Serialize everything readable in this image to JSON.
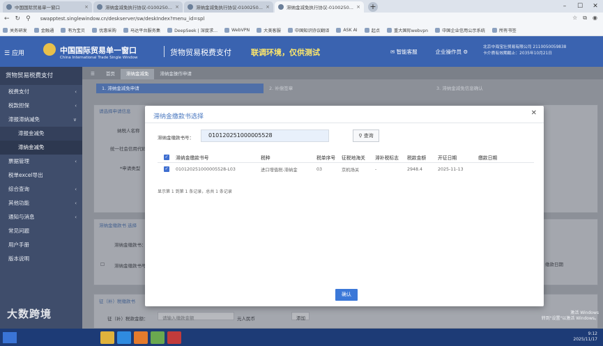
{
  "browser": {
    "tabs": [
      {
        "label": "中国国际贸易单一窗口",
        "active": false
      },
      {
        "label": "滞纳金减免执行协议-0100250...",
        "active": false
      },
      {
        "label": "滞纳金减免执行协议-0100250...",
        "active": false
      },
      {
        "label": "滞纳金减免执行协议-0100250...",
        "active": true
      }
    ],
    "url": "swapptest.singlewindow.cn/deskserver/sw/deskIndex?menu_id=spl",
    "bookmarks": [
      "关务研发",
      "金融通",
      "有为宝贝",
      "优惠采购",
      "马达平台服务集",
      "DeepSeek | 深度求...",
      "WebVPN",
      "大美客服",
      "中国知识协议翻译",
      "ASK AI",
      "起点",
      "重大国际webvpn",
      "中国企业信用公示系统",
      "所有书签"
    ]
  },
  "header": {
    "menu_label": "应用",
    "brand_cn": "中国国际贸易单一窗口",
    "brand_en": "China International Trade Single Window",
    "system_title": "货物贸易税费支付",
    "system_note": "联调环境，仅供测试",
    "service": "智能客服",
    "operator": "企业操作员",
    "corp_line1": "北京中海宝壮贸易有限公司 2110050059838",
    "corp_line2": "卡介质有效期截止：2035年10月21日"
  },
  "sidebar": {
    "title": "货物贸易税费支付",
    "items": [
      {
        "label": "税费支付",
        "chevron": true,
        "sub": false
      },
      {
        "label": "税款担保",
        "chevron": true,
        "sub": false
      },
      {
        "label": "滞报滞纳减免",
        "chevron": true,
        "sub": false
      },
      {
        "label": "滞报金减免",
        "chevron": false,
        "sub": true
      },
      {
        "label": "滞纳金减免",
        "chevron": false,
        "sub": true
      },
      {
        "label": "票据管理",
        "chevron": true,
        "sub": false
      },
      {
        "label": "税单excel导出",
        "chevron": false,
        "sub": false
      },
      {
        "label": "综合查询",
        "chevron": true,
        "sub": false
      },
      {
        "label": "其他功能",
        "chevron": true,
        "sub": false
      },
      {
        "label": "通知与消息",
        "chevron": true,
        "sub": false
      },
      {
        "label": "常见问题",
        "chevron": false,
        "sub": false
      },
      {
        "label": "用户手册",
        "chevron": false,
        "sub": false
      },
      {
        "label": "版本说明",
        "chevron": false,
        "sub": false
      }
    ]
  },
  "main": {
    "nav_tabs": [
      "首页",
      "滞纳金减免",
      "滞纳金操作申请"
    ],
    "steps": [
      "1. 滞纳金减免申请",
      "2. 补偿签章",
      "3. 滞纳金减免信息确认"
    ],
    "section_title": "请选择申请信息",
    "lbl_person": "纳税人名称",
    "lbl_credit": "统一社会信用代码",
    "lbl_apply": "*申请类型",
    "sec2_title": "滞纳金缴款书 选择",
    "lbl_sec2": "滞纳金缴款书：",
    "lbl_check": "滞纳金缴款书号",
    "sec3_title": "征（补）税缴款书",
    "lbl_amount": "征（补）税款金额：",
    "amount_placeholder": "请输入缴款金额",
    "unit": "元人民币",
    "add_btn": "添加",
    "date_col": "缴款日期"
  },
  "modal": {
    "title": "滞纳金缴款书选择",
    "field_label": "滞纳金缴款书号：",
    "field_value": "010120251000005528",
    "search_btn": "查询",
    "columns": [
      "滞纳金缴款书号",
      "税种",
      "税单序号",
      "征税地海关",
      "滞补税标志",
      "税款金额",
      "开征日期",
      "缴款日期"
    ],
    "rows": [
      {
        "no": "010120251000005528-L03",
        "type": "进口增值税-滞纳金",
        "seq": "03",
        "customs": "京机场关",
        "flag": "-",
        "amount": "2948.4",
        "start": "2025-11-13",
        "paid": ""
      }
    ],
    "page_info": "显示第 1 到第 1 条记录，总共 1 条记录",
    "confirm_btn": "确认"
  },
  "taskbar": {
    "watermark": "大数跨境",
    "time": "9:12",
    "date": "2025/11/17",
    "activation_1": "激活 Windows",
    "activation_2": "转到\"设置\"以激活 Windows。"
  },
  "colors": {
    "header": "#3a63b0",
    "sidebar": "#3f4d6b",
    "accent": "#3b78d8",
    "note": "#ffe86a"
  }
}
